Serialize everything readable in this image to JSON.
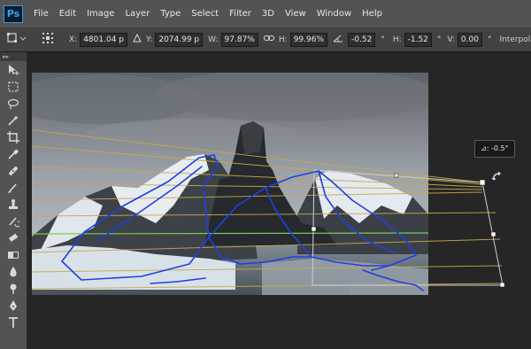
{
  "app": {
    "logo": "Ps"
  },
  "menu": [
    "File",
    "Edit",
    "Image",
    "Layer",
    "Type",
    "Select",
    "Filter",
    "3D",
    "View",
    "Window",
    "Help"
  ],
  "options": {
    "x_label": "X:",
    "x_value": "4801.04 p",
    "y_label": "Y:",
    "y_value": "2074.99 p",
    "w_label": "W:",
    "w_value": "97.87%",
    "h_label": "H:",
    "h_value": "99.96%",
    "rotate_value": "-0.52",
    "degree_symbol": "°",
    "hskew_label": "H:",
    "hskew_value": "-1.52",
    "vskew_label": "V:",
    "vskew_value": "0.00",
    "interpolation_label": "Interpolatio"
  },
  "toolbar": {
    "grip": "▸▸",
    "tools": [
      "move-tool",
      "marquee-tool",
      "lasso-tool",
      "magic-wand-tool",
      "crop-tool",
      "eyedropper-tool",
      "healing-brush-tool",
      "brush-tool",
      "clone-stamp-tool",
      "history-brush-tool",
      "eraser-tool",
      "gradient-tool",
      "blur-tool",
      "dodge-tool",
      "pen-tool",
      "type-tool"
    ]
  },
  "canvas": {
    "angle_readout": "⊿: -0.5°"
  },
  "colors": {
    "menubar": "#535353",
    "optionsbar": "#424242",
    "workspace": "#262626",
    "guide": "#c8a84a",
    "guide_green": "#7ec850",
    "sketch_blue": "#2040e0"
  }
}
